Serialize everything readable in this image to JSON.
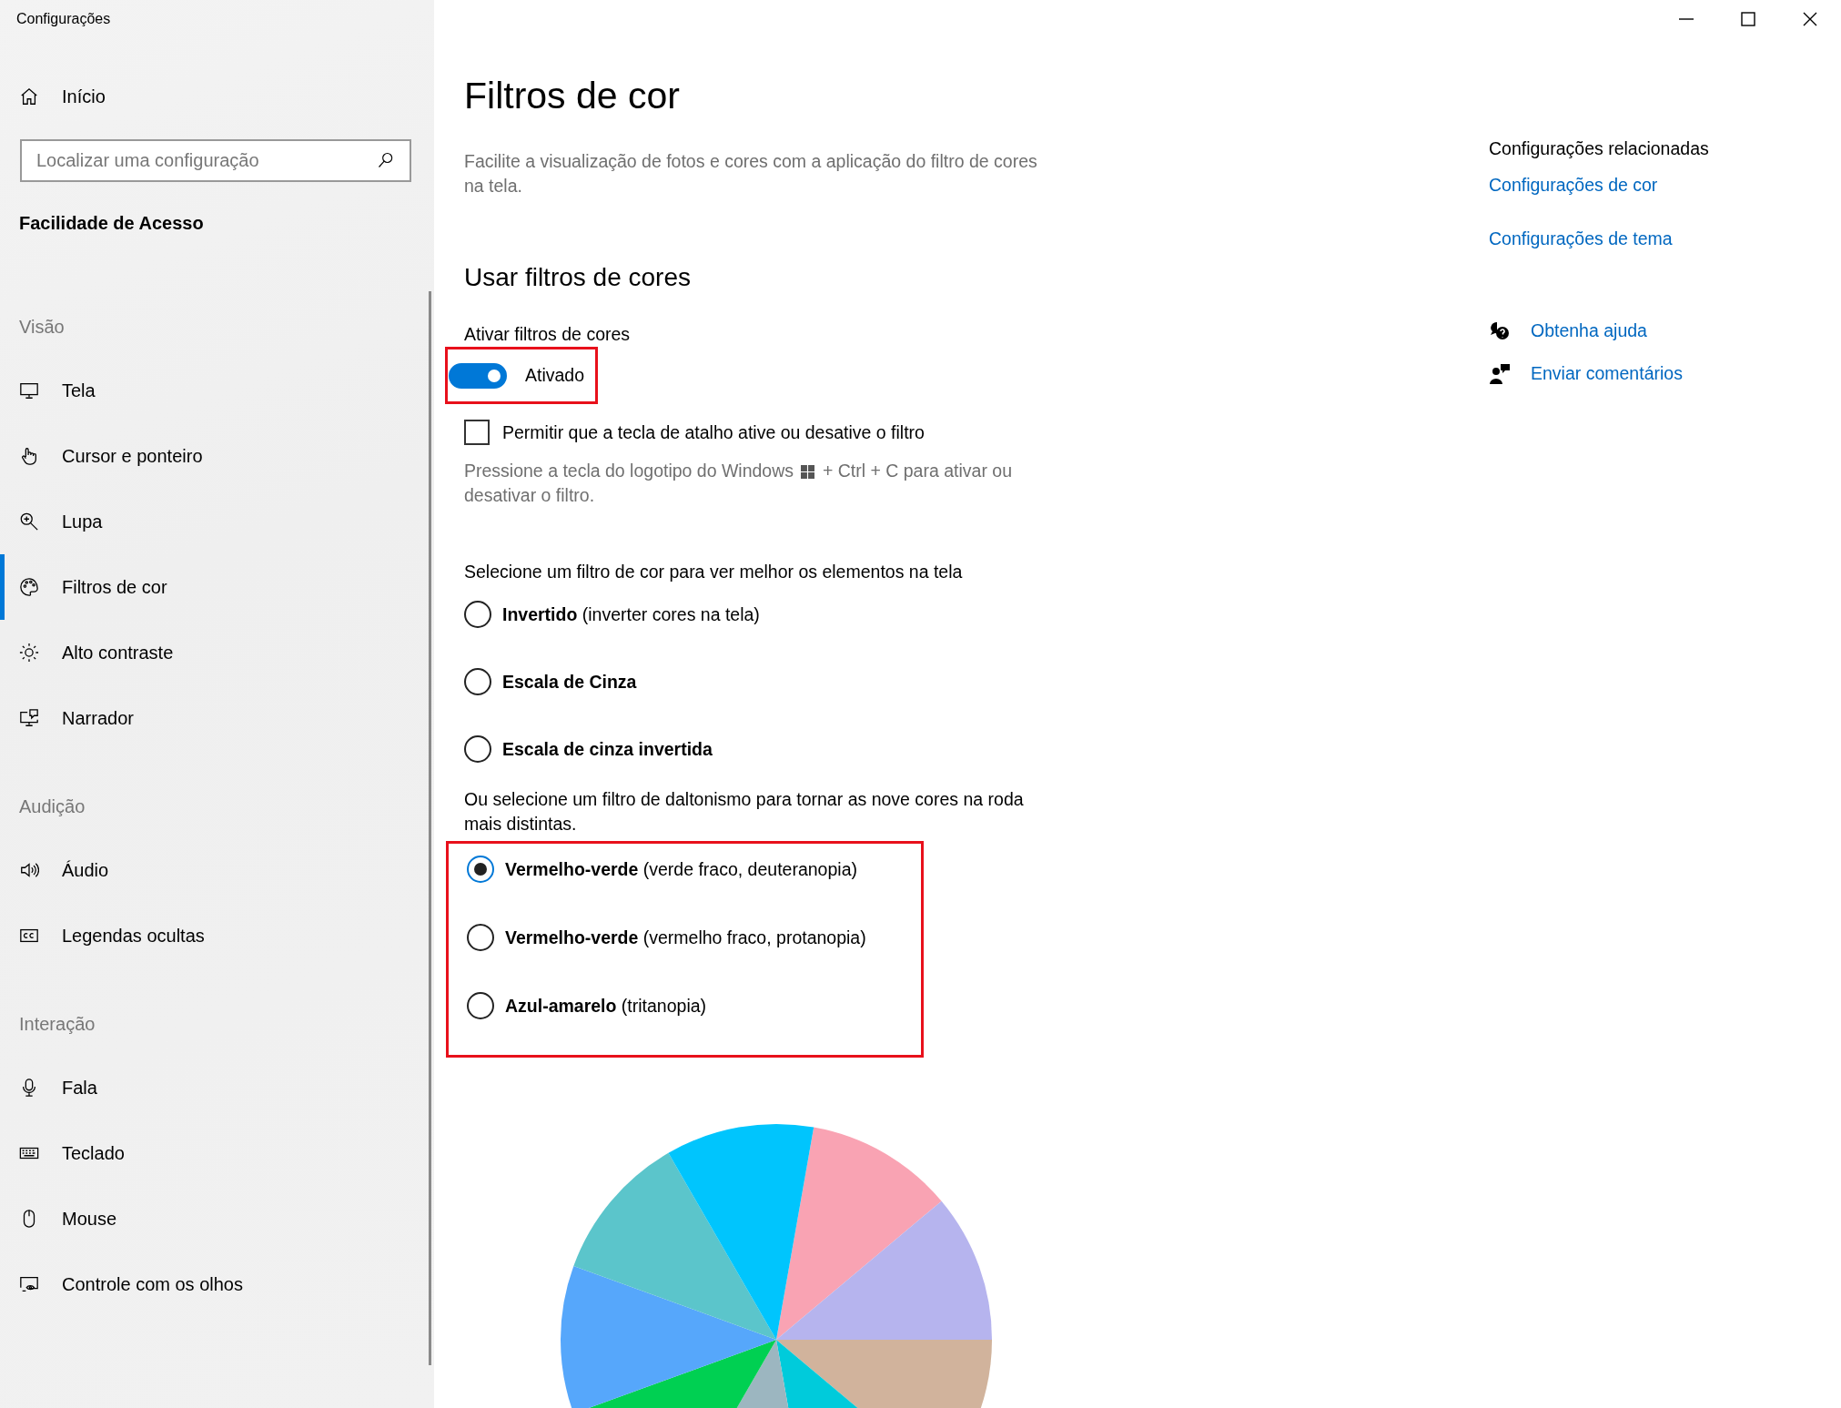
{
  "window": {
    "title": "Configurações"
  },
  "sidebar": {
    "home": {
      "label": "Início"
    },
    "search": {
      "placeholder": "Localizar uma configuração"
    },
    "category": "Facilidade de Acesso",
    "groups": [
      {
        "heading": "Visão",
        "items": [
          {
            "label": "Tela",
            "selected": false
          },
          {
            "label": "Cursor e ponteiro",
            "selected": false
          },
          {
            "label": "Lupa",
            "selected": false
          },
          {
            "label": "Filtros de cor",
            "selected": true
          },
          {
            "label": "Alto contraste",
            "selected": false
          },
          {
            "label": "Narrador",
            "selected": false
          }
        ]
      },
      {
        "heading": "Audição",
        "items": [
          {
            "label": "Áudio",
            "selected": false
          },
          {
            "label": "Legendas ocultas",
            "selected": false
          }
        ]
      },
      {
        "heading": "Interação",
        "items": [
          {
            "label": "Fala",
            "selected": false
          },
          {
            "label": "Teclado",
            "selected": false
          },
          {
            "label": "Mouse",
            "selected": false
          },
          {
            "label": "Controle com os olhos",
            "selected": false
          }
        ]
      }
    ]
  },
  "page": {
    "title": "Filtros de cor",
    "description": "Facilite a visualização de fotos e cores com a aplicação do filtro de cores na tela.",
    "section_title": "Usar filtros de cores",
    "toggle": {
      "label": "Ativar filtros de cores",
      "on": true,
      "state_text": "Ativado",
      "highlighted": true
    },
    "shortcut": {
      "label": "Permitir que a tecla de atalho ative ou desative o filtro",
      "checked": false,
      "hint_before": "Pressione a tecla do logotipo do Windows",
      "hint_after": "+ Ctrl + C para ativar ou",
      "hint_end": "desativar o filtro."
    },
    "filter_prompt": "Selecione um filtro de cor para ver melhor os elementos na tela",
    "filters": [
      {
        "name": "Invertido",
        "detail": "(inverter cores na tela)",
        "selected": false
      },
      {
        "name": "Escala de Cinza",
        "selected": false
      },
      {
        "name": "Escala de cinza invertida",
        "selected": false
      }
    ],
    "colorblind_prompt": "Ou selecione um filtro de daltonismo para tornar as nove cores na roda mais distintas.",
    "colorblind_group": {
      "highlighted": true,
      "filters": [
        {
          "name": "Vermelho-verde",
          "detail": "(verde fraco, deuteranopia)",
          "selected": true
        },
        {
          "name": "Vermelho-verde",
          "detail": "(vermelho fraco, protanopia)",
          "selected": false
        },
        {
          "name": "Azul-amarelo",
          "detail": "(tritanopia)",
          "selected": false
        }
      ]
    }
  },
  "related": {
    "heading": "Configurações relacionadas",
    "links": [
      "Configurações de cor",
      "Configurações de tema"
    ],
    "support": [
      "Obtenha ajuda",
      "Enviar comentários"
    ]
  }
}
